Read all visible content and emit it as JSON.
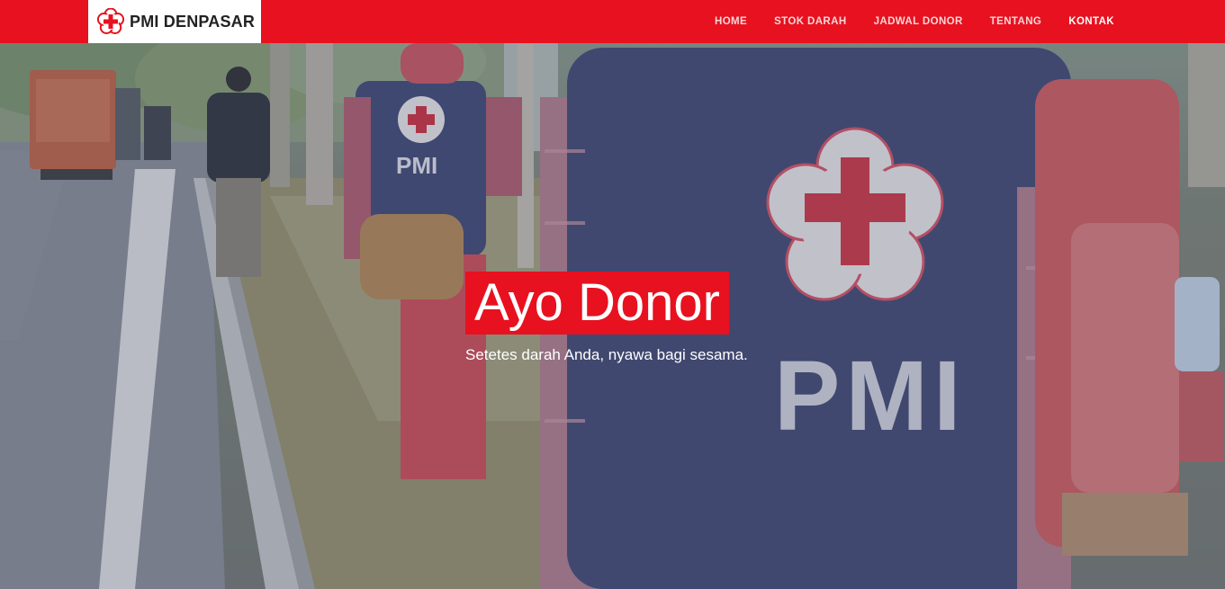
{
  "brand": {
    "name": "PMI DENPASAR",
    "logo_icon": "red-cross-flower-icon"
  },
  "nav": {
    "items": [
      {
        "label": "HOME"
      },
      {
        "label": "STOK DARAH"
      },
      {
        "label": "JADWAL DONOR"
      },
      {
        "label": "TENTANG"
      },
      {
        "label": "KONTAK"
      }
    ],
    "active": "KONTAK"
  },
  "hero": {
    "headline": "Ayo Donor",
    "subtitle": "Setetes darah Anda, nyawa bagi sesama.",
    "image": "volunteers-walking-photo",
    "vest_text": "PMI"
  },
  "colors": {
    "brand_red": "#e8111f",
    "navbar_text": "#f8d7d9"
  }
}
